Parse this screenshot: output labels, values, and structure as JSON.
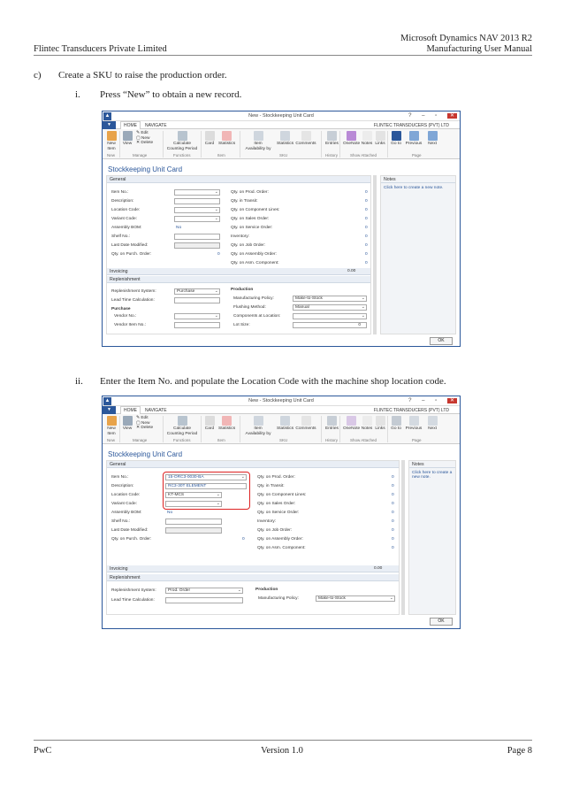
{
  "header": {
    "product": "Microsoft Dynamics NAV 2013 R2",
    "manual": "Manufacturing User Manual",
    "company": "Flintec Transducers Private Limited"
  },
  "steps": {
    "c_num": "c)",
    "c_text": "Create a SKU to raise the production order.",
    "i_num": "i.",
    "i_text": "Press “New” to obtain a new record.",
    "ii_num": "ii.",
    "ii_text": "Enter the Item No. and populate the Location Code with the machine shop location code."
  },
  "nav": {
    "window_title": "New - Stockkeeping Unit Card",
    "file_tab": "▼",
    "tab_home": "HOME",
    "tab_navigate": "NAVIGATE",
    "company_label": "FLINTEC TRANSDUCERS (PVT) LTD",
    "ribbon": {
      "new": "New Item",
      "view": "View",
      "edit": "Edit",
      "new_small": "New",
      "delete": "Delete",
      "calc": "Calculate Counting Period",
      "card": "Card",
      "statistics": "Statistics",
      "item_avail": "Item Availability by",
      "sku_stats": "Statistics",
      "comments": "Comments",
      "entries": "Entries",
      "onenote": "OneNote",
      "notes": "Notes",
      "links": "Links",
      "goto": "Go to",
      "previous": "Previous",
      "next": "Next",
      "grp_new": "New",
      "grp_manage": "Manage",
      "grp_functions": "Functions",
      "grp_item": "Item",
      "grp_sku": "SKU",
      "grp_history": "History",
      "grp_show_attached": "Show Attached",
      "grp_page": "Page"
    },
    "page_title": "Stockkeeping Unit Card",
    "general": "General",
    "notes_hd": "Notes",
    "notes_link": "Click here to create a new note.",
    "labels": {
      "item_no": "Item No.:",
      "description": "Description:",
      "location_code": "Location Code:",
      "variant_code": "Variant Code:",
      "assembly_bom": "Assembly BOM:",
      "shelf_no": "Shelf No.:",
      "last_modified": "Last Date Modified:",
      "qty_purch": "Qty. on Purch. Order:",
      "qty_prod": "Qty. on Prod. Order:",
      "in_transit": "Qty. in Transit:",
      "qty_comp_lines": "Qty. on Component Lines:",
      "qty_sales": "Qty. on Sales Order:",
      "qty_service": "Qty. on Service Order:",
      "inventory": "Inventory:",
      "qty_job": "Qty. on Job Order:",
      "qty_assembly": "Qty. on Assembly Order:",
      "qty_asm_comp": "Qty. on Asm. Component:"
    },
    "no_value": "No",
    "zero": "0",
    "zero_dec": "0.00",
    "invoicing": "Invoicing",
    "replenishment": "Replenishment",
    "repl_system_lbl": "Replenishment System:",
    "lead_time_lbl": "Lead Time Calculation:",
    "purchase_hd": "Purchase",
    "vendor_no_lbl": "Vendor No.:",
    "vendor_item_lbl": "Vendor Item No.:",
    "production_hd": "Production",
    "mfg_policy_lbl": "Manufacturing Policy:",
    "flushing_lbl": "Flushing Method:",
    "comp_loc_lbl": "Components at Location:",
    "lot_size_lbl": "Lot Size:",
    "ok": "OK",
    "win1": {
      "repl_system": "Purchase",
      "mfg_policy": "Make-to-Stock",
      "flushing": "Manual"
    },
    "win2": {
      "item_no": "15-ORC3-0030-BA",
      "description": "RC3-30T ELEMENT",
      "location_code": "KT-MCS",
      "repl_system": "Prod. Order",
      "mfg_policy": "Make-to-Stock"
    }
  },
  "footer": {
    "left": "PwC",
    "center": "Version 1.0",
    "right": "Page 8"
  }
}
